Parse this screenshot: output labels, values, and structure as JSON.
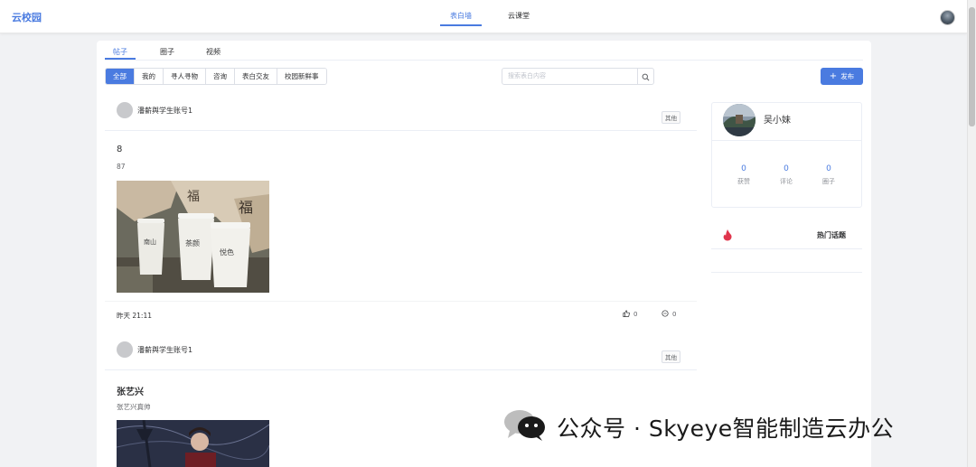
{
  "app": {
    "logo": "云校园"
  },
  "top_nav": {
    "tabs": [
      "表白墙",
      "云课堂"
    ],
    "active_index": 0
  },
  "sub_tabs": {
    "items": [
      "帖子",
      "圈子",
      "视频"
    ],
    "active_index": 0
  },
  "filters": {
    "items": [
      "全部",
      "我的",
      "寻人寻物",
      "咨询",
      "表白交友",
      "校园新鲜事"
    ],
    "active_index": 0
  },
  "search": {
    "placeholder": "搜索表白内容",
    "icon": "search-icon"
  },
  "post_button": {
    "icon": "plus-icon",
    "label": "发布"
  },
  "posts": [
    {
      "author": "潘薪舆学生账号1",
      "tag": "其他",
      "title": "8",
      "content": "87",
      "image": "milk-tea-cups-photo",
      "time": "昨天 21:11",
      "likes": "0",
      "comments": "0"
    },
    {
      "author": "潘薪舆学生账号1",
      "tag": "其他",
      "title": "张艺兴",
      "content": "张艺兴真帅",
      "image": "performer-photo"
    }
  ],
  "profile": {
    "name": "吴小妹",
    "stats": [
      {
        "value": "0",
        "label": "获赞"
      },
      {
        "value": "0",
        "label": "评论"
      },
      {
        "value": "0",
        "label": "圈子"
      }
    ]
  },
  "hot_topics": {
    "title": "热门话题",
    "icon": "fire-icon"
  },
  "watermark": {
    "text": "公众号 · Skyeye智能制造云办公",
    "icon": "wechat-icon"
  },
  "colors": {
    "accent": "#4a7be0",
    "fire": "#e0354c"
  }
}
